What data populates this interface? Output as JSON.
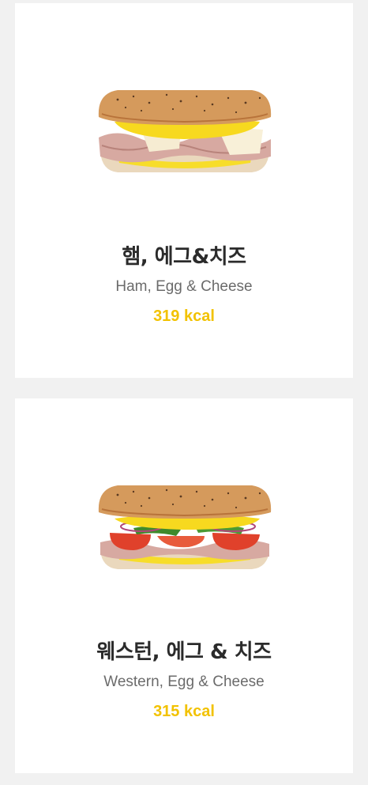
{
  "menu_items": [
    {
      "name_ko": "햄, 에그&치즈",
      "name_en": "Ham, Egg & Cheese",
      "calories": "319 kcal",
      "image": "ham-egg-cheese-sandwich"
    },
    {
      "name_ko": "웨스턴, 에그 & 치즈",
      "name_en": "Western, Egg & Cheese",
      "calories": "315 kcal",
      "image": "western-egg-cheese-sandwich"
    }
  ],
  "colors": {
    "background": "#f1f1f1",
    "card": "#ffffff",
    "title": "#2b2b2b",
    "subtitle": "#6b6b6b",
    "calories": "#f2c200"
  }
}
